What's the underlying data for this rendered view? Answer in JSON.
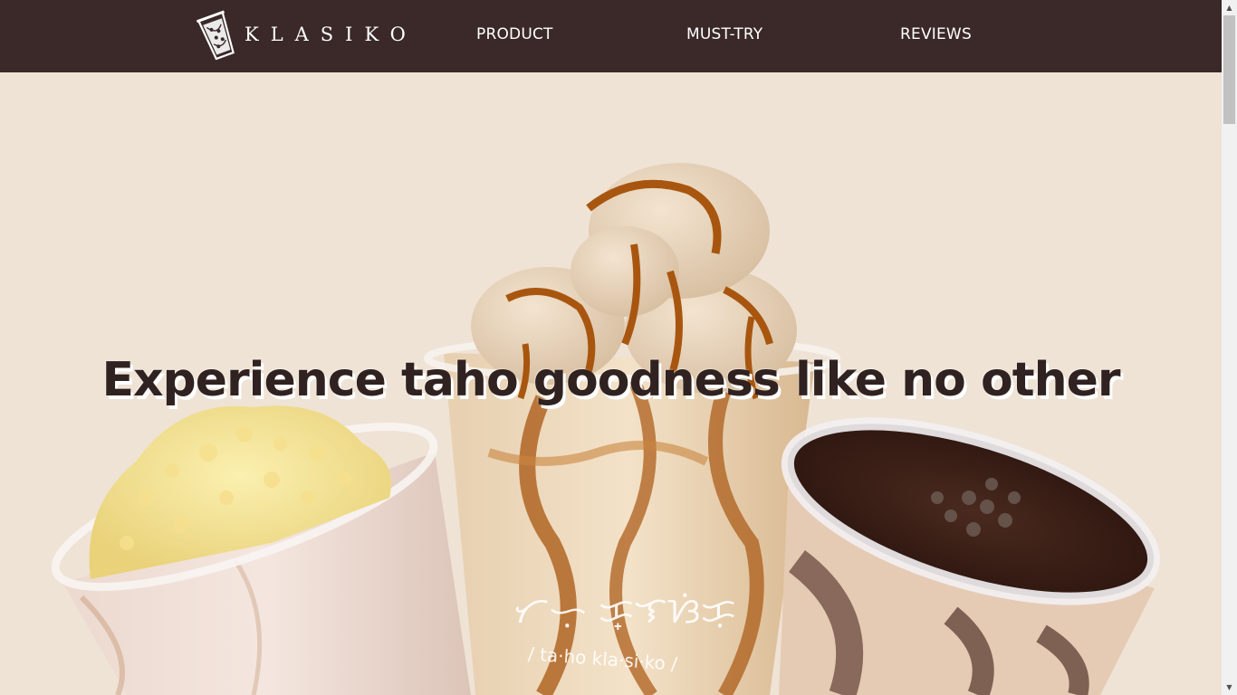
{
  "brand": {
    "name": "KLASIKO"
  },
  "nav": {
    "items": [
      {
        "label": "PRODUCT"
      },
      {
        "label": "MUST-TRY"
      },
      {
        "label": "REVIEWS"
      }
    ]
  },
  "hero": {
    "headline": "Experience taho goodness like no other",
    "cup_print_brand": "ᜆᜑᜓ ᜃ᜔ᜎᜐᜒᜃᜓ",
    "cup_print_phonetic": "/ ta·ho  kla·si·ko /"
  },
  "colors": {
    "navbar": "#3a2928",
    "page_background": "#efe3d6",
    "headline": "#2f2220",
    "caramel": "#a8560f",
    "chocolate": "#3a1a12"
  }
}
